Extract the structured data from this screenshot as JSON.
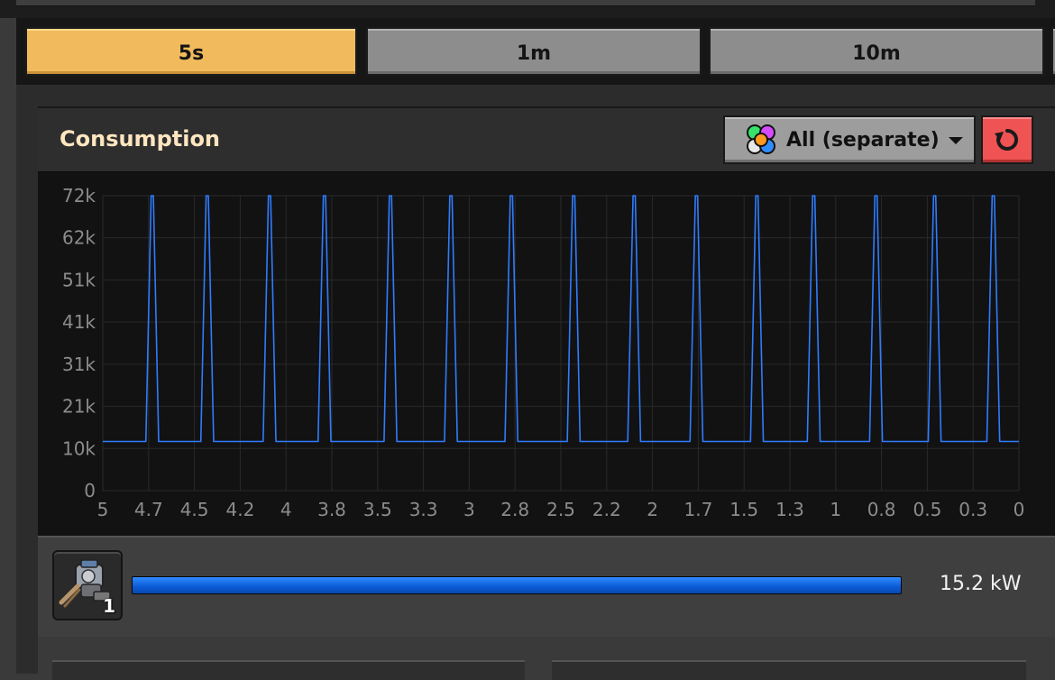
{
  "tabs": [
    {
      "label": "5s",
      "active": true
    },
    {
      "label": "1m",
      "active": false
    },
    {
      "label": "10m",
      "active": false
    }
  ],
  "header": {
    "title": "Consumption",
    "dropdown_label": "All (separate)",
    "reset_icon": "reset-icon",
    "filter_icon": "multicolor-circles-icon"
  },
  "consumer": {
    "icon": "gun-turret-icon",
    "count": "1",
    "value": "15.2 kW",
    "bar_fraction": 1.0
  },
  "colors": {
    "active_tab": "#f1ba5c",
    "line": "#2f7cff",
    "reset_button": "#f05353",
    "title": "#ffe6c0"
  },
  "chart_data": {
    "type": "line",
    "title": "",
    "xlabel": "",
    "ylabel": "",
    "x_ticks": [
      "5",
      "4.7",
      "4.5",
      "4.2",
      "4",
      "3.8",
      "3.5",
      "3.3",
      "3",
      "2.8",
      "2.5",
      "2.2",
      "2",
      "1.7",
      "1.5",
      "1.3",
      "1",
      "0.8",
      "0.5",
      "0.3",
      "0"
    ],
    "y_ticks": [
      "72k",
      "62k",
      "51k",
      "41k",
      "31k",
      "21k",
      "10k",
      "0"
    ],
    "xlim": [
      5,
      0
    ],
    "ylim": [
      0,
      72000
    ],
    "grid": true,
    "series": [
      {
        "baseline": 12000,
        "peak": 72000,
        "spike_x": [
          4.73,
          4.43,
          4.09,
          3.79,
          3.43,
          3.1,
          2.77,
          2.43,
          2.1,
          1.76,
          1.43,
          1.12,
          0.78,
          0.46,
          0.14
        ],
        "x_end": 0
      }
    ]
  }
}
